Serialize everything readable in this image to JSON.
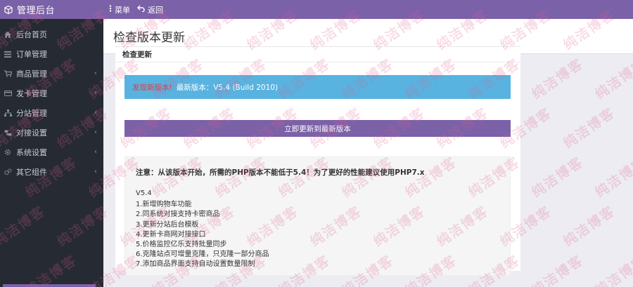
{
  "topbar": {
    "brand": "管理后台",
    "menu_label": "菜单",
    "back_label": "返回"
  },
  "sidebar": {
    "items": [
      {
        "label": "后台首页",
        "icon": "home-icon",
        "has_children": false
      },
      {
        "label": "订单管理",
        "icon": "list-icon",
        "has_children": false
      },
      {
        "label": "商品管理",
        "icon": "cart-icon",
        "has_children": true
      },
      {
        "label": "发卡管理",
        "icon": "card-icon",
        "has_children": true
      },
      {
        "label": "分站管理",
        "icon": "sitemap-icon",
        "has_children": true
      },
      {
        "label": "对接设置",
        "icon": "link-icon",
        "has_children": true
      },
      {
        "label": "系统设置",
        "icon": "gear-icon",
        "has_children": true
      },
      {
        "label": "其它组件",
        "icon": "cogs-icon",
        "has_children": true
      }
    ]
  },
  "page": {
    "title": "检查版本更新"
  },
  "panel": {
    "title": "检查更新",
    "alert_warn": "发现新版本!",
    "alert_text": "最新版本：V5.4 (Build 2010)",
    "update_button": "立即更新到最新版本",
    "notice": "注意：从该版本开始，所需的PHP版本不能低于5.4！为了更好的性能建议使用PHP7.x",
    "version": "V5.4",
    "changes": [
      "1.新增购物车功能",
      "2.同系统对接支持卡密商品",
      "3.更新分站后台模板",
      "4.更新卡商网对接接口",
      "5.价格监控亿乐支持批量同步",
      "6.克隆站点可增量克隆，只克隆一部分商品",
      "7.添加商品界面支持自动设置数量限制"
    ]
  },
  "watermark": "纯洁博客",
  "colors": {
    "brand_purple": "#7b61a8",
    "sidebar_bg": "#262a33",
    "alert_blue": "#58b3e0",
    "alert_warn_red": "#e23b3b",
    "watermark_pink": "#e15f8c"
  }
}
